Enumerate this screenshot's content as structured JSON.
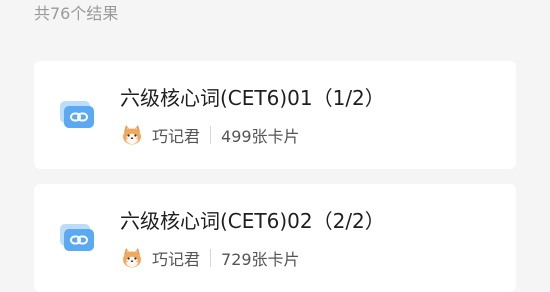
{
  "search": {
    "result_count": "共76个结果"
  },
  "results": [
    {
      "title": "六级核心词(CET6)01（1/2）",
      "author": "巧记君",
      "card_count": "499张卡片"
    },
    {
      "title": "六级核心词(CET6)02（2/2）",
      "author": "巧记君",
      "card_count": "729张卡片"
    }
  ],
  "colors": {
    "background": "#f5f5f5",
    "card": "#ffffff",
    "icon_blue": "#5aa9f2",
    "title_text": "#1f1f1f",
    "meta_text": "#555555",
    "muted_text": "#9a9a9a"
  },
  "icons": {
    "deck": "deck-link-icon",
    "author_avatar": "shiba-avatar"
  }
}
